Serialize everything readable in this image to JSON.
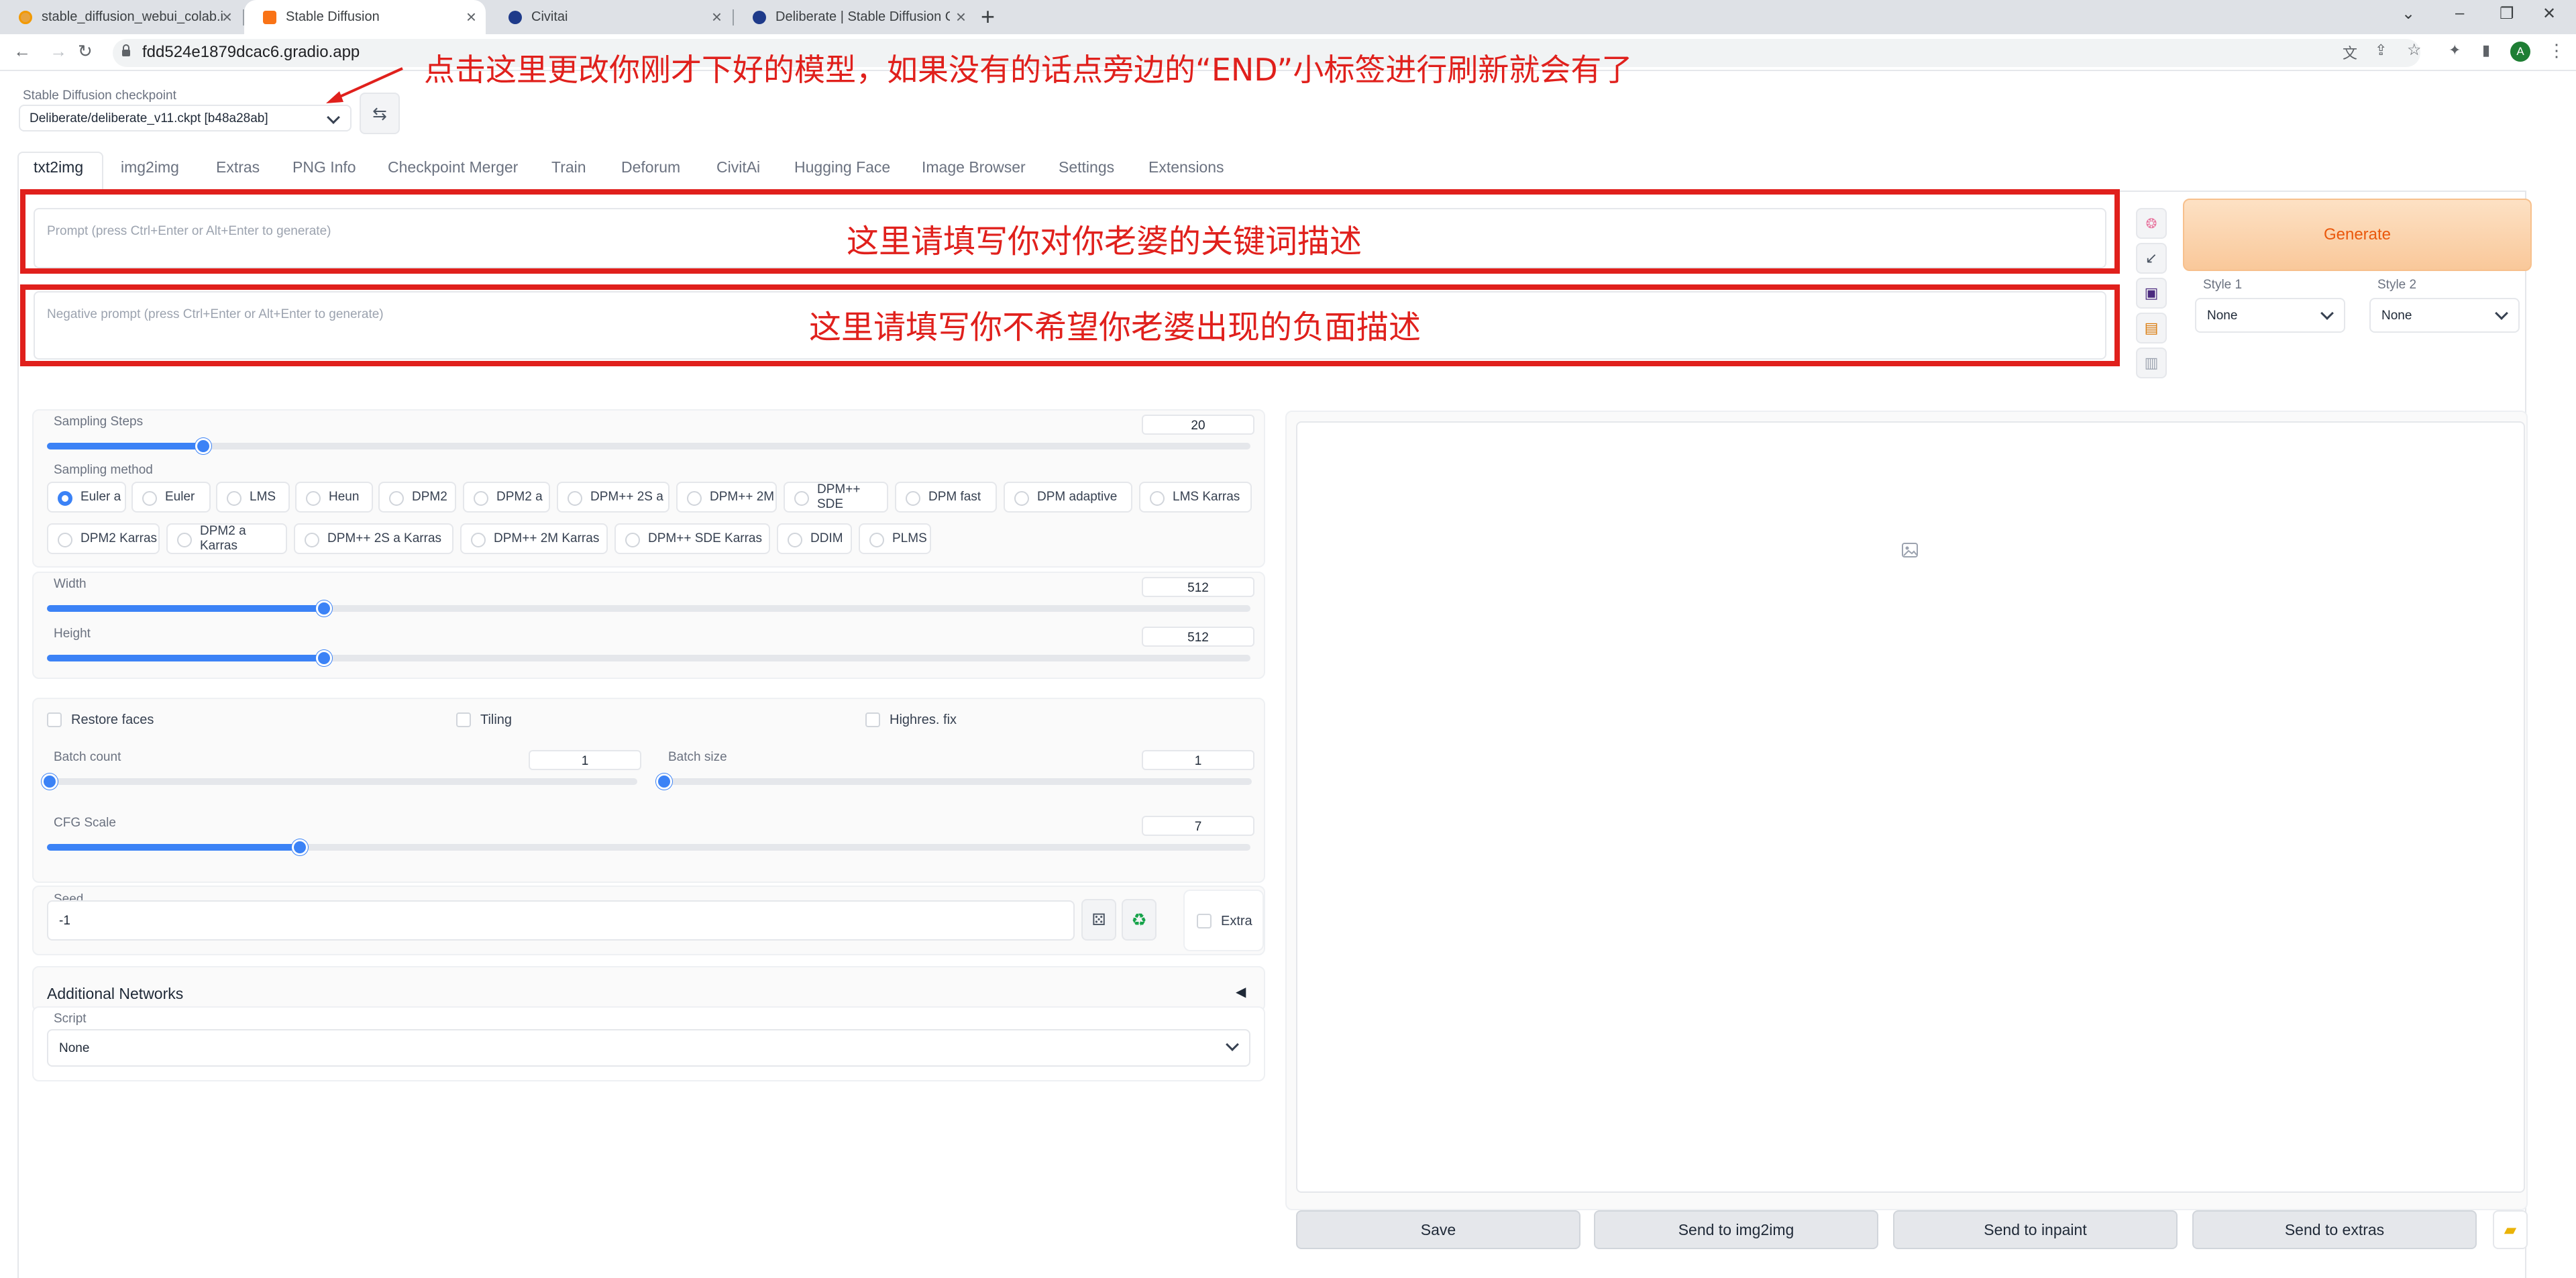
{
  "browser": {
    "tabs": [
      {
        "title": "stable_diffusion_webui_colab.i"
      },
      {
        "title": "Stable Diffusion"
      },
      {
        "title": "Civitai"
      },
      {
        "title": "Deliberate | Stable Diffusion C"
      }
    ],
    "url": "fdd524e1879dcac6.gradio.app",
    "profile_initial": "A"
  },
  "checkpoint": {
    "label": "Stable Diffusion checkpoint",
    "value": "Deliberate/deliberate_v11.ckpt [b48a28ab]"
  },
  "annotations": {
    "top": "点击这里更改你刚才下好的模型，如果没有的话点旁边的“END”小标签进行刷新就会有了",
    "prompt": "这里请填写你对你老婆的关键词描述",
    "negative": "这里请填写你不希望你老婆出现的负面描述"
  },
  "app_tabs": [
    "txt2img",
    "img2img",
    "Extras",
    "PNG Info",
    "Checkpoint Merger",
    "Train",
    "Deforum",
    "CivitAi",
    "Hugging Face",
    "Image Browser",
    "Settings",
    "Extensions"
  ],
  "prompt": {
    "placeholder": "Prompt (press Ctrl+Enter or Alt+Enter to generate)"
  },
  "negative_prompt": {
    "placeholder": "Negative prompt (press Ctrl+Enter or Alt+Enter to generate)"
  },
  "generate": {
    "label": "Generate"
  },
  "styles": [
    {
      "label": "Style 1",
      "value": "None"
    },
    {
      "label": "Style 2",
      "value": "None"
    }
  ],
  "sampling_steps": {
    "label": "Sampling Steps",
    "value": "20",
    "fraction": 0.13
  },
  "sampling_method": {
    "label": "Sampling method",
    "options": [
      "Euler a",
      "Euler",
      "LMS",
      "Heun",
      "DPM2",
      "DPM2 a",
      "DPM++ 2S a",
      "DPM++ 2M",
      "DPM++ SDE",
      "DPM fast",
      "DPM adaptive",
      "LMS Karras",
      "DPM2 Karras",
      "DPM2 a Karras",
      "DPM++ 2S a Karras",
      "DPM++ 2M Karras",
      "DPM++ SDE Karras",
      "DDIM",
      "PLMS"
    ],
    "selected": "Euler a"
  },
  "width": {
    "label": "Width",
    "value": "512",
    "fraction": 0.23
  },
  "height": {
    "label": "Height",
    "value": "512",
    "fraction": 0.23
  },
  "checks": {
    "restore_faces": "Restore faces",
    "tiling": "Tiling",
    "highres": "Highres. fix"
  },
  "batch_count": {
    "label": "Batch count",
    "value": "1"
  },
  "batch_size": {
    "label": "Batch size",
    "value": "1"
  },
  "cfg_scale": {
    "label": "CFG Scale",
    "value": "7",
    "fraction": 0.21
  },
  "seed": {
    "label": "Seed",
    "value": "-1",
    "extra": "Extra"
  },
  "additional_networks": {
    "label": "Additional Networks",
    "arrow": "◀"
  },
  "script": {
    "label": "Script",
    "value": "None"
  },
  "output_buttons": {
    "save": "Save",
    "img2img": "Send to img2img",
    "inpaint": "Send to inpaint",
    "extras": "Send to extras"
  },
  "colors": {
    "accent": "#3b82f6",
    "annotation": "#e0201c",
    "generate_text": "#ea580c"
  }
}
